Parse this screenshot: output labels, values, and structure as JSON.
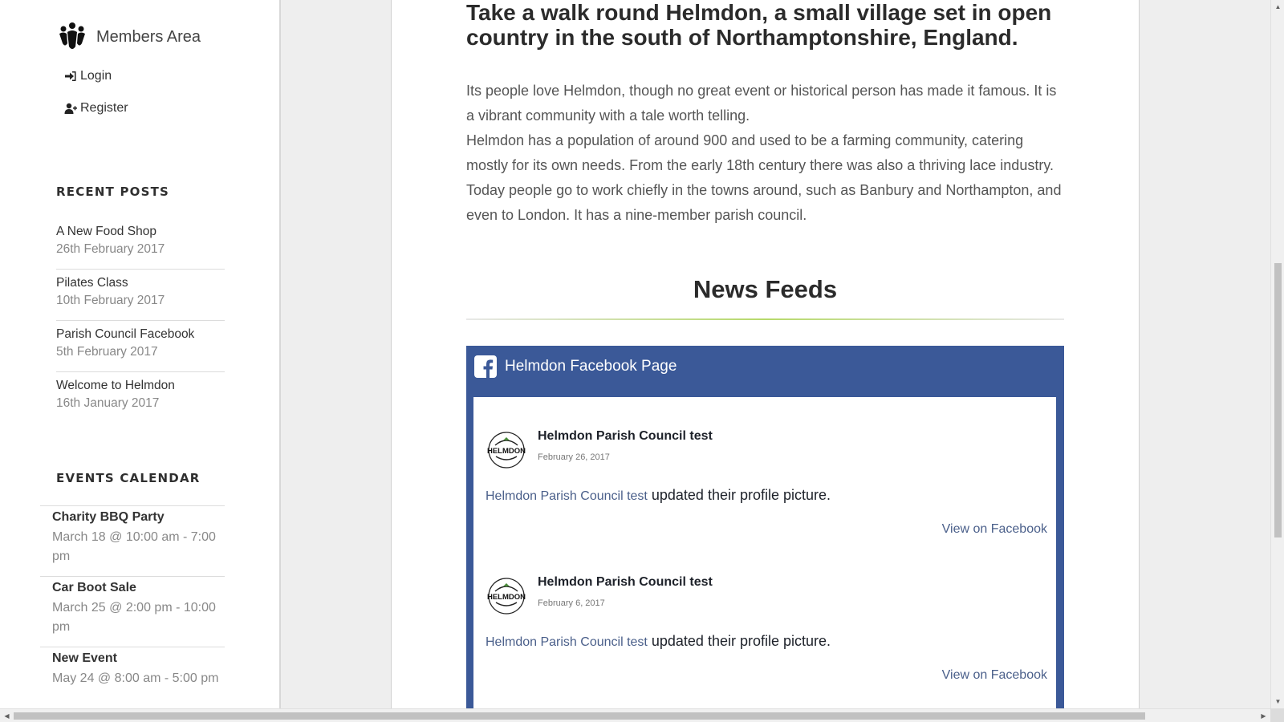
{
  "sidebar": {
    "members_title": "Members Area",
    "login_label": "Login",
    "register_label": "Register",
    "recent_posts_title": "RECENT POSTS",
    "recent_posts": [
      {
        "title": "A New Food Shop",
        "date": "26th February 2017"
      },
      {
        "title": "Pilates Class",
        "date": "10th February 2017"
      },
      {
        "title": "Parish Council Facebook",
        "date": "5th February 2017"
      },
      {
        "title": "Welcome to Helmdon",
        "date": "16th January 2017"
      }
    ],
    "events_title": "EVENTS CALENDAR",
    "events": [
      {
        "name": "Charity BBQ Party",
        "time": "March 18 @ 10:00 am - 7:00 pm"
      },
      {
        "name": "Car Boot Sale",
        "time": "March 25 @ 2:00 pm - 10:00 pm"
      },
      {
        "name": "New Event",
        "time": "May 24 @ 8:00 am - 5:00 pm"
      }
    ]
  },
  "main": {
    "headline": "Take a walk round Helmdon, a small village set in open country in the south of Northamptonshire, England.",
    "paragraph1": "Its people love Helmdon, though no great event or historical person has made it famous. It is a vibrant community with a tale worth telling.",
    "paragraph2": "Helmdon has a population of around 900 and used to be a farming community, catering mostly for its own needs. From the early 18th century there was also a thriving lace industry. Today people go to work chiefly in the towns around, such as Banbury and Northampton, and even to London. It has a nine-member parish council.",
    "news_title": "News Feeds",
    "facebook": {
      "page_title": "Helmdon Facebook Page",
      "posts": [
        {
          "author": "Helmdon Parish Council test",
          "date": "February 26, 2017",
          "link_text": "Helmdon Parish Council test",
          "text": " updated their profile picture.",
          "view_label": "View on Facebook",
          "avatar_text": "HELMDON"
        },
        {
          "author": "Helmdon Parish Council test",
          "date": "February 6, 2017",
          "link_text": "Helmdon Parish Council test",
          "text": " updated their profile picture.",
          "view_label": "View on Facebook",
          "avatar_text": "HELMDON"
        }
      ]
    }
  },
  "colors": {
    "facebook_blue": "#3b5998",
    "link_color": "#4a5f8a",
    "accent_rule": "#b6d96a"
  },
  "icons": {
    "members_logo": "people-group-icon",
    "login": "sign-in-icon",
    "register": "user-plus-icon",
    "facebook": "facebook-square-icon"
  }
}
